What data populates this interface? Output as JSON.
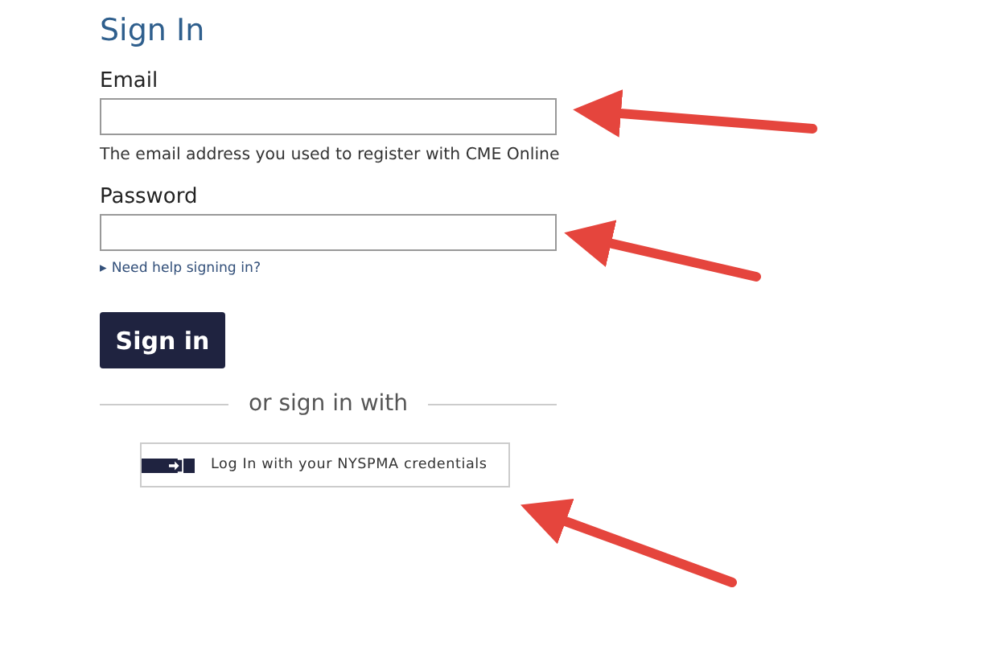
{
  "heading": "Sign In",
  "email": {
    "label": "Email",
    "hint": "The email address you used to register with CME Online"
  },
  "password": {
    "label": "Password"
  },
  "help_link": {
    "marker": "▸",
    "label": "Need help signing in?"
  },
  "submit": "Sign in",
  "divider": "or sign in with",
  "sso_button": {
    "label": "Log In with your NYSPMA credentials"
  }
}
